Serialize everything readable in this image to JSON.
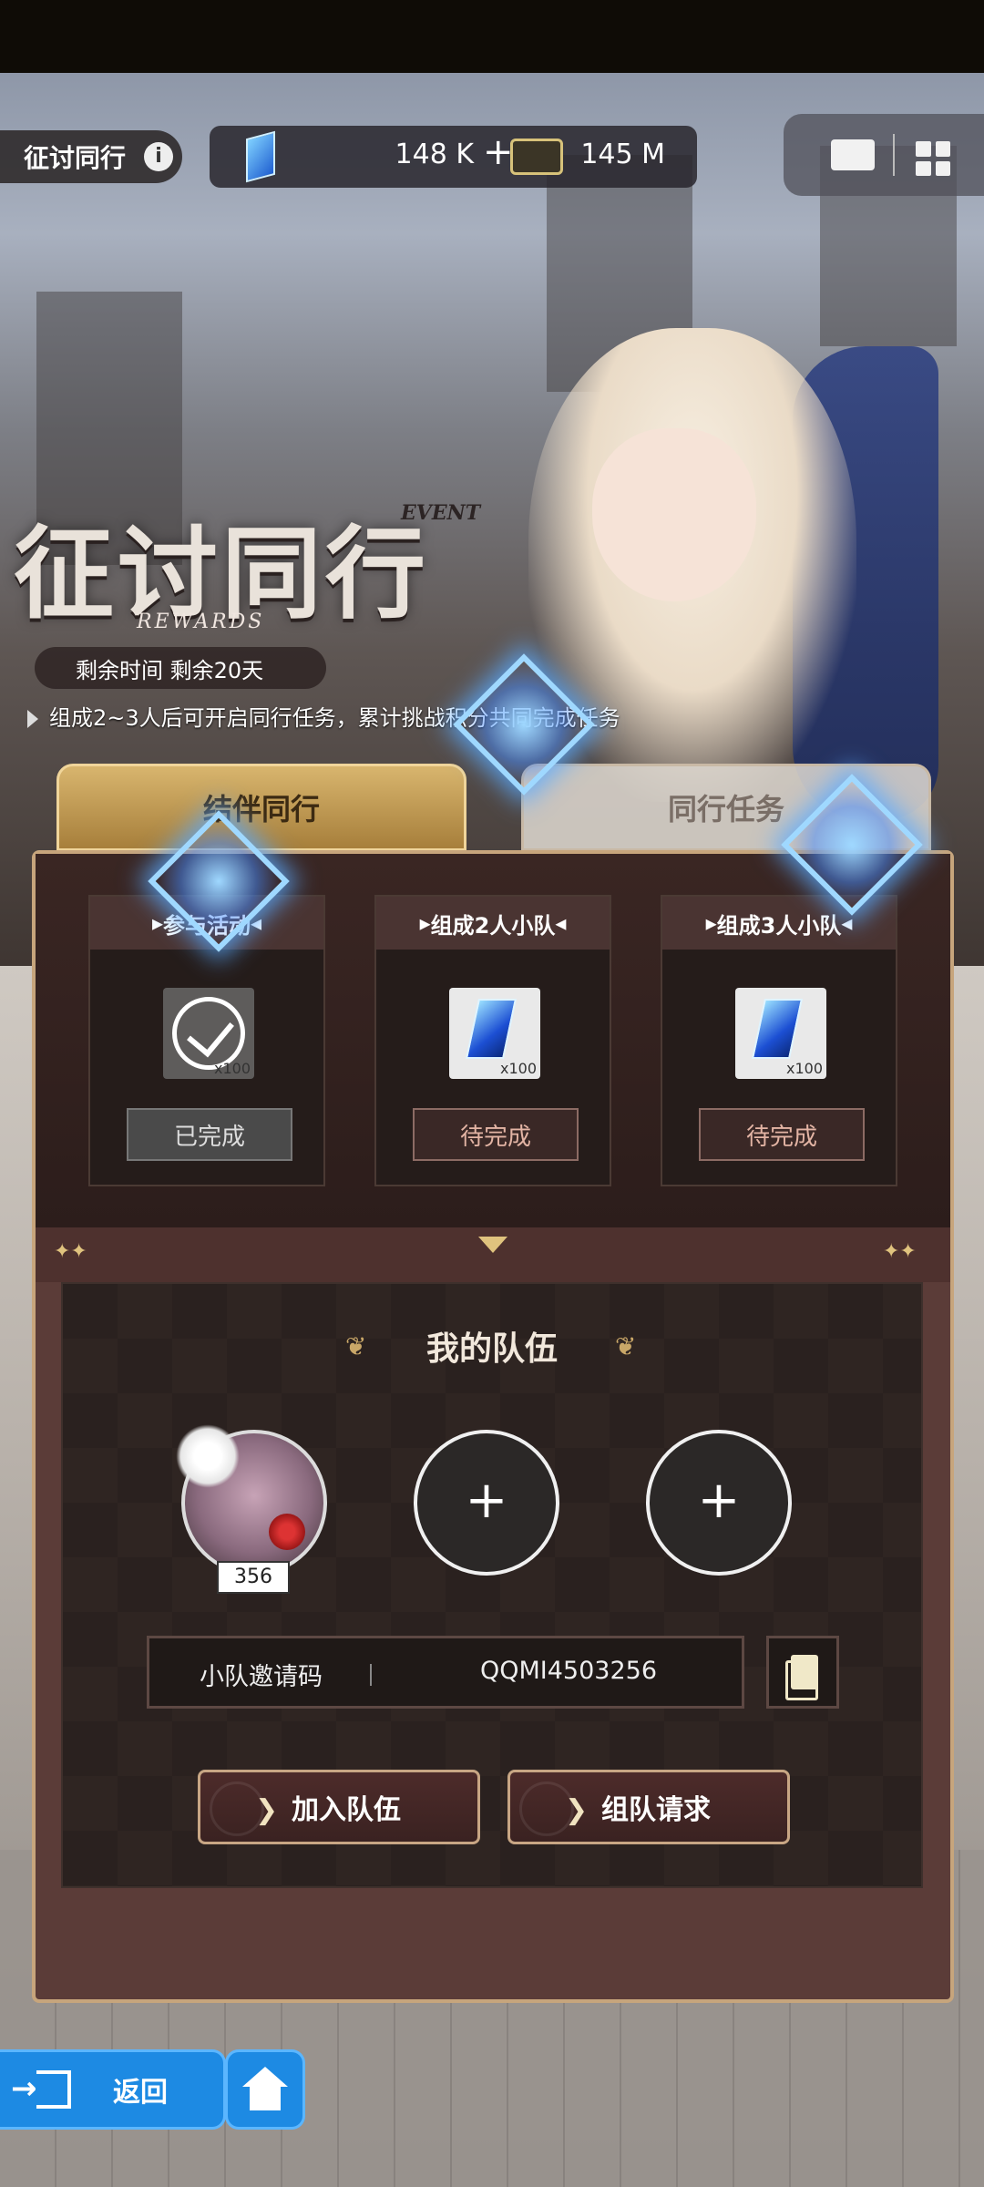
{
  "header": {
    "title": "征讨同行",
    "info_symbol": "i",
    "gems": "148 K",
    "gems_plus": "+",
    "coins": "145 M",
    "icons": [
      "mail-icon",
      "menu-grid-icon"
    ]
  },
  "banner": {
    "title": "征讨同行",
    "event_tag": "EVENT",
    "rewards_tag": "REWARDS",
    "time_left": "剩余时间  剩余20天",
    "description": "组成2~3人后可开启同行任务，累计挑战积分共同完成任务"
  },
  "tabs": [
    {
      "label": "结伴同行",
      "active": true
    },
    {
      "label": "同行任务",
      "active": false
    }
  ],
  "tasks": [
    {
      "title": "参与活动",
      "reward_count": "x100",
      "status": "已完成",
      "completed": true
    },
    {
      "title": "组成2人小队",
      "reward_count": "x100",
      "status": "待完成",
      "completed": false
    },
    {
      "title": "组成3人小队",
      "reward_count": "x100",
      "status": "待完成",
      "completed": false
    }
  ],
  "team": {
    "title": "我的队伍",
    "leader_level": "356",
    "empty_slot_symbol": "+",
    "invite_label": "小队邀请码",
    "invite_code": "QQMI4503256",
    "join_button": "加入队伍",
    "request_button": "组队请求"
  },
  "nav": {
    "back_label": "返回"
  },
  "colors": {
    "accent_gold": "#d8b56e",
    "panel_dark": "#2a211f",
    "nav_blue": "#1d8ae3"
  }
}
